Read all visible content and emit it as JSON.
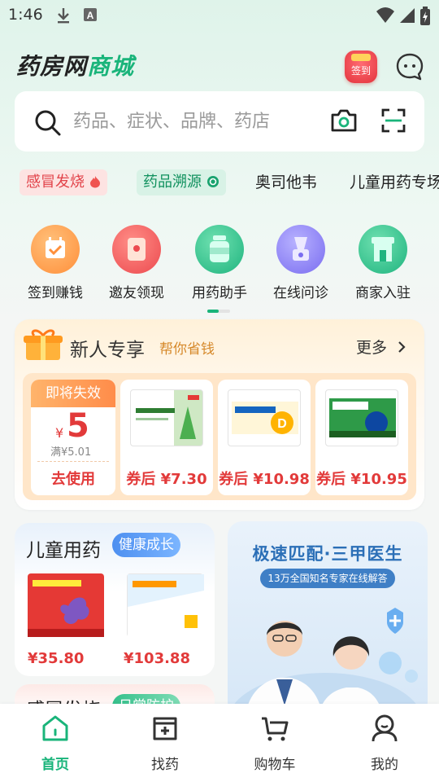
{
  "status_bar": {
    "time": "1:46",
    "icons": [
      "download-icon",
      "a-icon",
      "wifi-icon",
      "signal-icon",
      "battery-icon"
    ]
  },
  "header": {
    "logo_part1": "药房网",
    "logo_part2": "商城",
    "checkin_label": "签到",
    "message_icon": "chat-bubble-icon"
  },
  "search": {
    "placeholder": "药品、症状、品牌、药店"
  },
  "hot_tags": [
    {
      "label": "感冒发烧",
      "icon": "flame-icon"
    },
    {
      "label": "药品溯源",
      "icon": "spiral-icon"
    },
    {
      "label": "奥司他韦"
    },
    {
      "label": "儿童用药专场"
    }
  ],
  "quick_nav": [
    {
      "label": "签到赚钱",
      "icon": "calendar-check-icon"
    },
    {
      "label": "邀友领现",
      "icon": "gift-envelope-icon"
    },
    {
      "label": "用药助手",
      "icon": "medicine-bottle-icon"
    },
    {
      "label": "在线问诊",
      "icon": "consult-icon"
    },
    {
      "label": "商家入驻",
      "icon": "storefront-icon"
    }
  ],
  "new_user": {
    "title": "新人专享",
    "subtitle": "帮你省钱",
    "more": "更多",
    "coupon": {
      "badge": "即将失效",
      "currency": "¥",
      "amount": "5",
      "condition": "满¥5.01",
      "action": "去使用"
    },
    "products": [
      {
        "price": "券后 ¥7.30"
      },
      {
        "price": "券后 ¥10.98"
      },
      {
        "price": "券后 ¥10.95"
      }
    ]
  },
  "kids": {
    "title": "儿童用药",
    "tag": "健康成长",
    "products": [
      {
        "price": "¥35.80"
      },
      {
        "price": "¥103.88"
      }
    ]
  },
  "doctor_banner": {
    "title": "极速匹配·三甲医生",
    "subtitle": "13万全国知名专家在线解答"
  },
  "next_section": {
    "title": "感冒发烧",
    "tag": "日常防护"
  },
  "tabbar": [
    {
      "label": "首页",
      "icon": "home-icon",
      "active": true
    },
    {
      "label": "找药",
      "icon": "medicine-box-icon",
      "active": false
    },
    {
      "label": "购物车",
      "icon": "cart-icon",
      "active": false
    },
    {
      "label": "我的",
      "icon": "profile-icon",
      "active": false
    }
  ],
  "colors": {
    "brand_green": "#19b47a",
    "price_red": "#e23a3a",
    "accent_orange": "#d6892b"
  }
}
